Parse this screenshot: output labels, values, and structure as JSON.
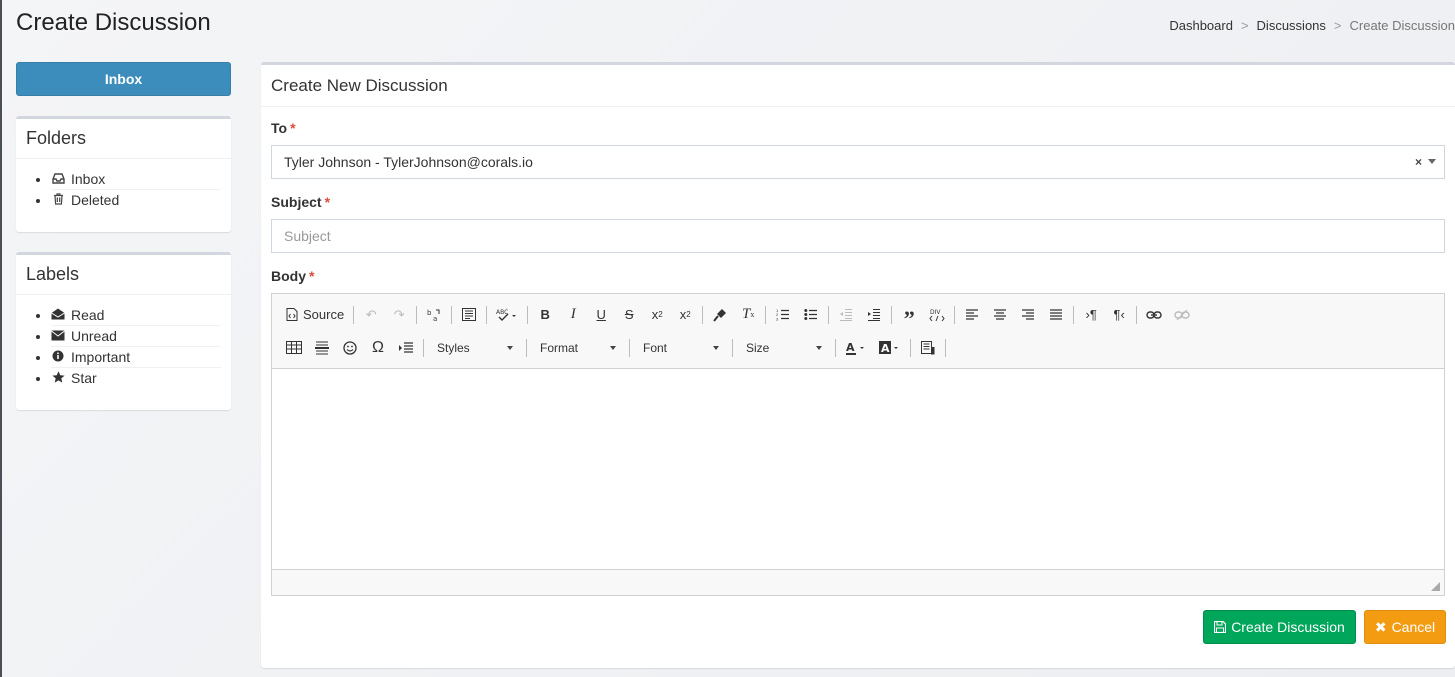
{
  "page": {
    "title": "Create Discussion"
  },
  "breadcrumb": [
    "Dashboard",
    "Discussions",
    "Create Discussion"
  ],
  "sidebar": {
    "inbox_button": "Inbox",
    "folders": {
      "title": "Folders",
      "items": [
        {
          "label": "Inbox",
          "icon": "inbox-icon"
        },
        {
          "label": "Deleted",
          "icon": "trash-icon"
        }
      ]
    },
    "labels": {
      "title": "Labels",
      "items": [
        {
          "label": "Read",
          "icon": "envelope-open-icon"
        },
        {
          "label": "Unread",
          "icon": "envelope-icon"
        },
        {
          "label": "Important",
          "icon": "info-circle-icon"
        },
        {
          "label": "Star",
          "icon": "star-icon"
        }
      ]
    }
  },
  "form": {
    "header": "Create New Discussion",
    "to_label": "To",
    "to_value": "Tyler Johnson - TylerJohnson@corals.io",
    "subject_label": "Subject",
    "subject_placeholder": "Subject",
    "body_label": "Body",
    "required_mark": "*"
  },
  "editor": {
    "source_label": "Source",
    "combos": [
      "Styles",
      "Format",
      "Font",
      "Size"
    ]
  },
  "actions": {
    "create_label": "Create Discussion",
    "cancel_label": "Cancel"
  },
  "colors": {
    "primary": "#3c8dbc",
    "success": "#00a65a",
    "warning": "#f39c12",
    "required": "#dd4b39"
  }
}
